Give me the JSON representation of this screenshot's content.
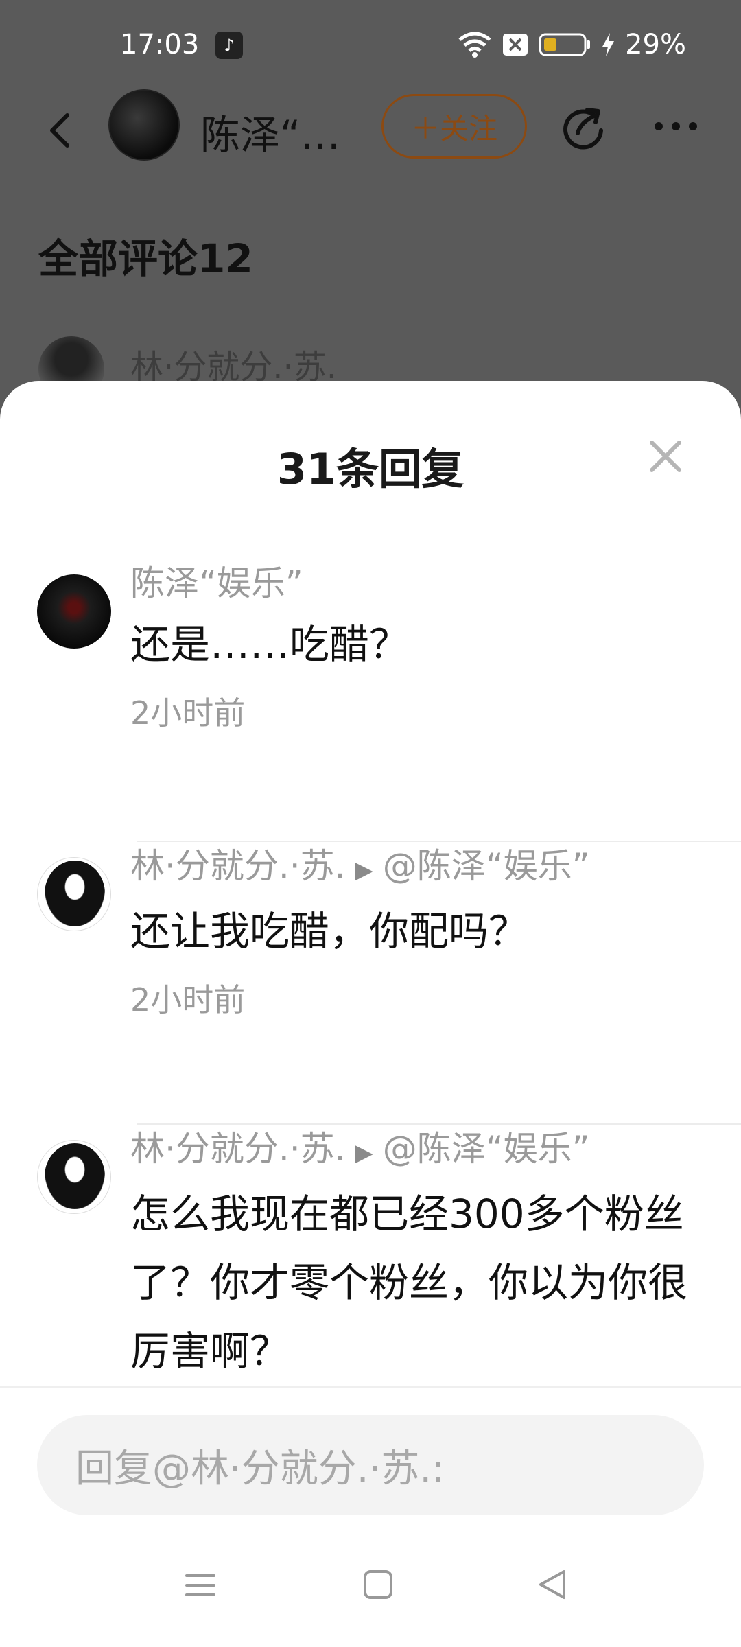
{
  "status_bar": {
    "time": "17:03",
    "battery": "29%"
  },
  "header": {
    "name": "陈泽“…",
    "follow_label": "＋关注"
  },
  "comments_title": "全部评论12",
  "background_comment": {
    "author": "林·分就分.·苏."
  },
  "sheet": {
    "title": "31条回复",
    "replies": [
      {
        "author": "陈泽“娱乐”",
        "reply_to": "",
        "text": "还是……吃醋？",
        "time": "2小时前"
      },
      {
        "author": "林·分就分.·苏.",
        "reply_to": "@陈泽“娱乐”",
        "text": "还让我吃醋，你配吗？",
        "time": "2小时前"
      },
      {
        "author": "林·分就分.·苏.",
        "reply_to": "@陈泽“娱乐”",
        "text": "怎么我现在都已经300多个粉丝了？你才零个粉丝，你以为你很厉害啊？",
        "time": ""
      }
    ],
    "input_placeholder": "回复@林·分就分.·苏.:"
  },
  "icons": {
    "back": "chevron-left-icon",
    "share": "share-icon",
    "more": "more-icon",
    "close": "close-icon"
  },
  "colors": {
    "follow_accent": "#8c4a12",
    "overlay_bg": "#5a5a5a"
  }
}
